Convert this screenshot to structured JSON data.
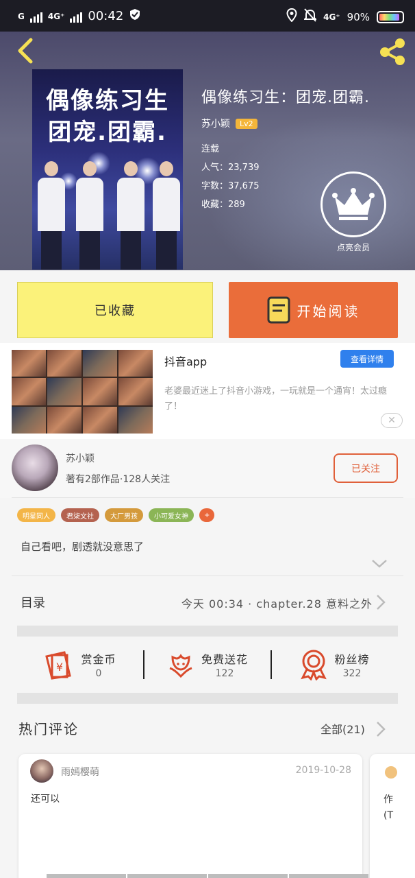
{
  "status_bar": {
    "network": "G",
    "network2": "4G⁺",
    "time": "00:42",
    "mobile": "4G⁺",
    "battery": "90%"
  },
  "book": {
    "cover_title_line1": "偶像练习生",
    "cover_title_line2": "团宠.团霸.",
    "title": "偶像练习生：团宠.团霸.",
    "author": "苏小颖",
    "level": "Lv2",
    "status": "连载",
    "popularity": "人气：23,739",
    "words": "字数：37,675",
    "favorites": "收藏：289",
    "vip_label": "点亮会员"
  },
  "actions": {
    "collected": "已收藏",
    "read": "开始阅读"
  },
  "ad": {
    "name": "抖音app",
    "detail_button": "查看详情",
    "description": "老婆最近迷上了抖音小游戏，一玩就是一个通宵！太过瘾了！",
    "close": "✕"
  },
  "author_section": {
    "name": "苏小颖",
    "stats": "著有2部作品·128人关注",
    "follow": "已关注"
  },
  "tags": [
    {
      "label": "明星同人",
      "color": "#f3b548"
    },
    {
      "label": "君柒文社",
      "color": "#b4624f"
    },
    {
      "label": "大厂男孩",
      "color": "#d49a3c"
    },
    {
      "label": "小可爱女神",
      "color": "#8bb556"
    },
    {
      "label": "+",
      "color": "#e9673a"
    }
  ],
  "summary": "自己看吧，剧透就没意思了",
  "catalog": {
    "label": "目录",
    "latest": "今天 00:34 · chapter.28 意料之外"
  },
  "rewards": [
    {
      "label": "赏金币",
      "value": "0",
      "icon": "coin-envelope-icon"
    },
    {
      "label": "免费送花",
      "value": "122",
      "icon": "flower-icon"
    },
    {
      "label": "粉丝榜",
      "value": "322",
      "icon": "medal-icon"
    }
  ],
  "comments": {
    "title": "热门评论",
    "all": "全部(21)",
    "items": [
      {
        "user": "雨嫣樱萌",
        "date": "2019-10-28",
        "text": "还可以"
      }
    ],
    "partial_line1": "作",
    "partial_line2": "(T"
  },
  "colors": {
    "accent": "#ea6d3a",
    "collected_bg": "#fbf27a",
    "blue": "#2f80ed",
    "icon_red": "#d94a2c"
  }
}
